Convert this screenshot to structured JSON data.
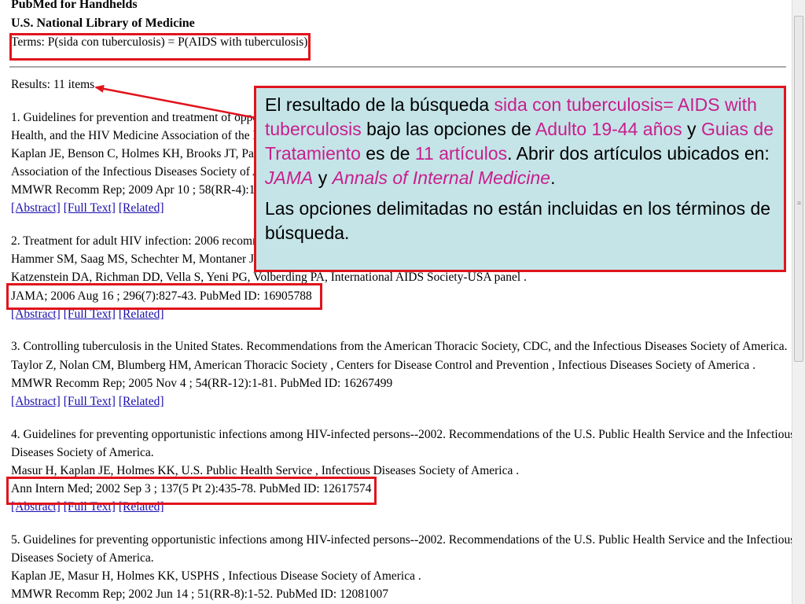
{
  "header": {
    "title": "PubMed for Handhelds",
    "org": "U.S. National Library of Medicine",
    "terms": "Terms: P(sida con tuberculosis) = P(AIDS with tuberculosis)"
  },
  "results_summary": "Results: 11 items",
  "link_labels": {
    "abstract": "[Abstract]",
    "full_text": "[Full Text]",
    "related": "[Related]"
  },
  "results": [
    {
      "lines": [
        "1. Guidelines for prevention and treatment of oppor",
        "Health, and the HIV Medicine Association of the In",
        "Kaplan JE, Benson C, Holmes KH, Brooks JT, Pau",
        "Association of the Infectious Diseases Society of Ar",
        "MMWR Recomm Rep; 2009 Apr 10 ; 58(RR-4):1"
      ]
    },
    {
      "lines": [
        "2. Treatment for adult HIV infection: 2006 recomme",
        "Hammer SM, Saag MS, Schechter M, Montaner JS",
        "Katzenstein DA, Richman DD, Vella S, Yeni PG, Volberding PA, International AIDS Society-USA panel .",
        "JAMA; 2006 Aug 16 ; 296(7):827-43. PubMed ID: 16905788"
      ]
    },
    {
      "lines": [
        "3. Controlling tuberculosis in the United States. Recommendations from the American Thoracic Society, CDC, and the Infectious Diseases Society of America.",
        "Taylor Z, Nolan CM, Blumberg HM, American Thoracic Society , Centers for Disease Control and Prevention , Infectious Diseases Society of America .",
        "MMWR Recomm Rep; 2005 Nov 4 ; 54(RR-12):1-81. PubMed ID: 16267499"
      ]
    },
    {
      "lines": [
        "4. Guidelines for preventing opportunistic infections among HIV-infected persons--2002. Recommendations of the U.S. Public Health Service and the Infectious",
        "Diseases Society of America.",
        "Masur H, Kaplan JE, Holmes KK, U.S. Public Health Service , Infectious Diseases Society of America .",
        "Ann Intern Med; 2002 Sep 3 ; 137(5 Pt 2):435-78. PubMed ID: 12617574"
      ]
    },
    {
      "lines": [
        "5. Guidelines for preventing opportunistic infections among HIV-infected persons--2002. Recommendations of the U.S. Public Health Service and the Infectious",
        "Diseases Society of America.",
        "Kaplan JE, Masur H, Holmes KK, USPHS , Infectious Disease Society of America .",
        "MMWR Recomm Rep; 2002 Jun 14 ; 51(RR-8):1-52. PubMed ID: 12081007"
      ]
    }
  ],
  "callout": {
    "p1": {
      "t1": "El resultado de la búsqueda ",
      "t2": "sida con tuberculosis= AIDS with tuberculosis",
      "t3": " bajo las opciones de ",
      "t4": "Adulto 19-44 años",
      "t5": " y ",
      "t6": "Guias de Tratamiento",
      "t7": " es de ",
      "t8": "11 artículos",
      "t9": ". Abrir dos artículos ubicados en: ",
      "t10": "JAMA",
      "t11": " y ",
      "t12": "Annals of Internal Medicine",
      "t13": "."
    },
    "p2": "Las opciones delimitadas no están incluidas en los términos de búsqueda."
  },
  "colors": {
    "highlight_border": "#e0141c",
    "callout_bg": "#c5e4e8",
    "callout_accent": "#c81e8c",
    "link": "#1a0dab"
  }
}
